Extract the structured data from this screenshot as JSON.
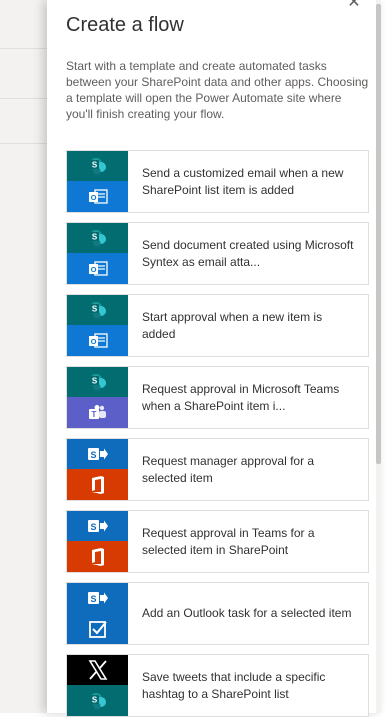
{
  "panel": {
    "title": "Create a flow",
    "description": "Start with a template and create automated tasks between your SharePoint data and other apps. Choosing a template will open the Power Automate site where you'll finish creating your flow.",
    "close_glyph": "✕"
  },
  "colors": {
    "sharepoint_teal": "#036c70",
    "sharepoint_blue": "#0f6cbd",
    "outlook_blue": "#0f78d4",
    "office_red": "#d83b01",
    "teams_purple": "#5b5fc7",
    "x_black": "#000000"
  },
  "templates": [
    {
      "label": "Send a customized email when a new SharePoint list item is added",
      "top_icon": "sharepoint-icon",
      "bottom_icon": "outlook-icon"
    },
    {
      "label": "Send document created using Microsoft Syntex as email atta...",
      "top_icon": "sharepoint-icon",
      "bottom_icon": "outlook-icon"
    },
    {
      "label": "Start approval when a new item is added",
      "top_icon": "sharepoint-icon",
      "bottom_icon": "outlook-icon"
    },
    {
      "label": "Request approval in Microsoft Teams when a SharePoint item i...",
      "top_icon": "sharepoint-icon",
      "bottom_icon": "teams-icon"
    },
    {
      "label": "Request manager approval for a selected item",
      "top_icon": "sharepoint-trigger-icon",
      "bottom_icon": "office-icon"
    },
    {
      "label": "Request approval in Teams for a selected item in SharePoint",
      "top_icon": "sharepoint-trigger-icon",
      "bottom_icon": "office-icon"
    },
    {
      "label": "Add an Outlook task for a selected item",
      "top_icon": "sharepoint-trigger-icon",
      "bottom_icon": "todo-checkbox-icon"
    },
    {
      "label": "Save tweets that include a specific hashtag to a SharePoint list",
      "top_icon": "x-icon",
      "bottom_icon": "sharepoint-icon"
    }
  ]
}
